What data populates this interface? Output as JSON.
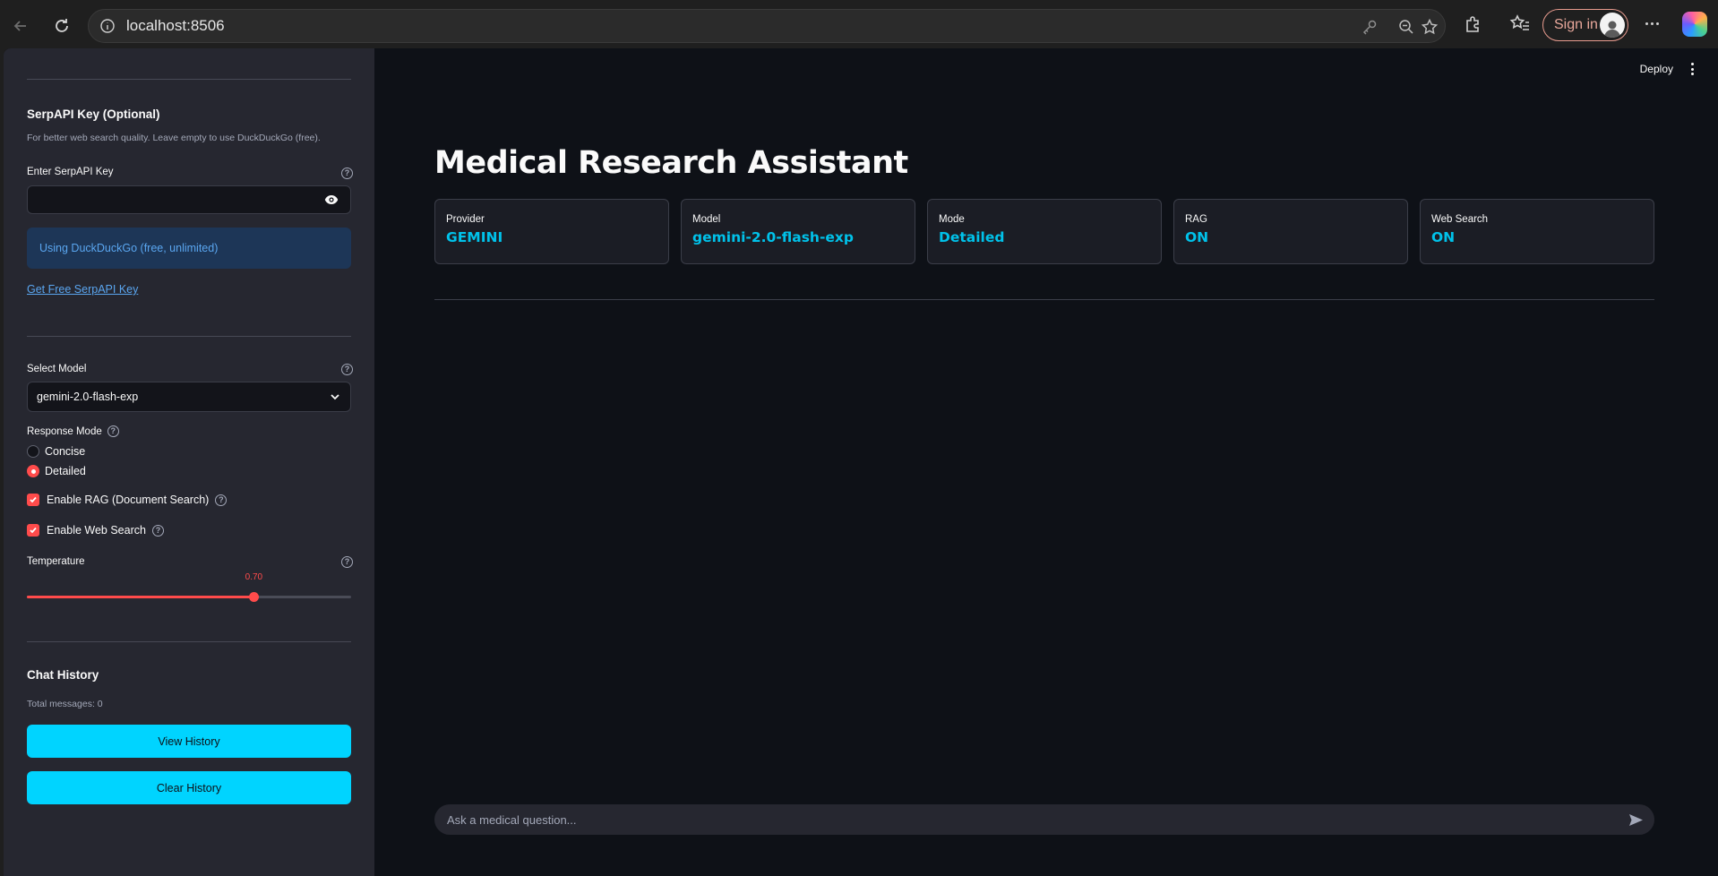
{
  "browser": {
    "url": "localhost:8506",
    "sign_in_label": "Sign in"
  },
  "sidebar": {
    "serpapi": {
      "heading": "SerpAPI Key (Optional)",
      "caption": "For better web search quality. Leave empty to use DuckDuckGo (free).",
      "input_label": "Enter SerpAPI Key",
      "input_value": "",
      "info_text": "Using DuckDuckGo (free, unlimited)",
      "link_text": "Get Free SerpAPI Key"
    },
    "model": {
      "label": "Select Model",
      "selected": "gemini-2.0-flash-exp"
    },
    "response_mode": {
      "label": "Response Mode",
      "options": [
        "Concise",
        "Detailed"
      ],
      "selected": "Detailed"
    },
    "enable_rag": {
      "label": "Enable RAG (Document Search)",
      "checked": true
    },
    "enable_web_search": {
      "label": "Enable Web Search",
      "checked": true
    },
    "temperature": {
      "label": "Temperature",
      "value": 0.7,
      "display": "0.70",
      "min": 0,
      "max": 1
    },
    "chat_history": {
      "heading": "Chat History",
      "total_messages": "Total messages: 0",
      "view_button": "View History",
      "clear_button": "Clear History"
    }
  },
  "main": {
    "deploy_label": "Deploy",
    "title": "Medical Research Assistant",
    "cards": [
      {
        "label": "Provider",
        "value": "GEMINI"
      },
      {
        "label": "Model",
        "value": "gemini-2.0-flash-exp"
      },
      {
        "label": "Mode",
        "value": "Detailed"
      },
      {
        "label": "RAG",
        "value": "ON"
      },
      {
        "label": "Web Search",
        "value": "ON"
      }
    ],
    "chat_placeholder": "Ask a medical question..."
  },
  "colors": {
    "accent": "#ff4b4b",
    "cyan": "#00d4ff",
    "sidebar_bg": "#262730",
    "main_bg": "#0e1117",
    "info_bg": "#1d3657",
    "info_text": "#5aa6f0"
  }
}
